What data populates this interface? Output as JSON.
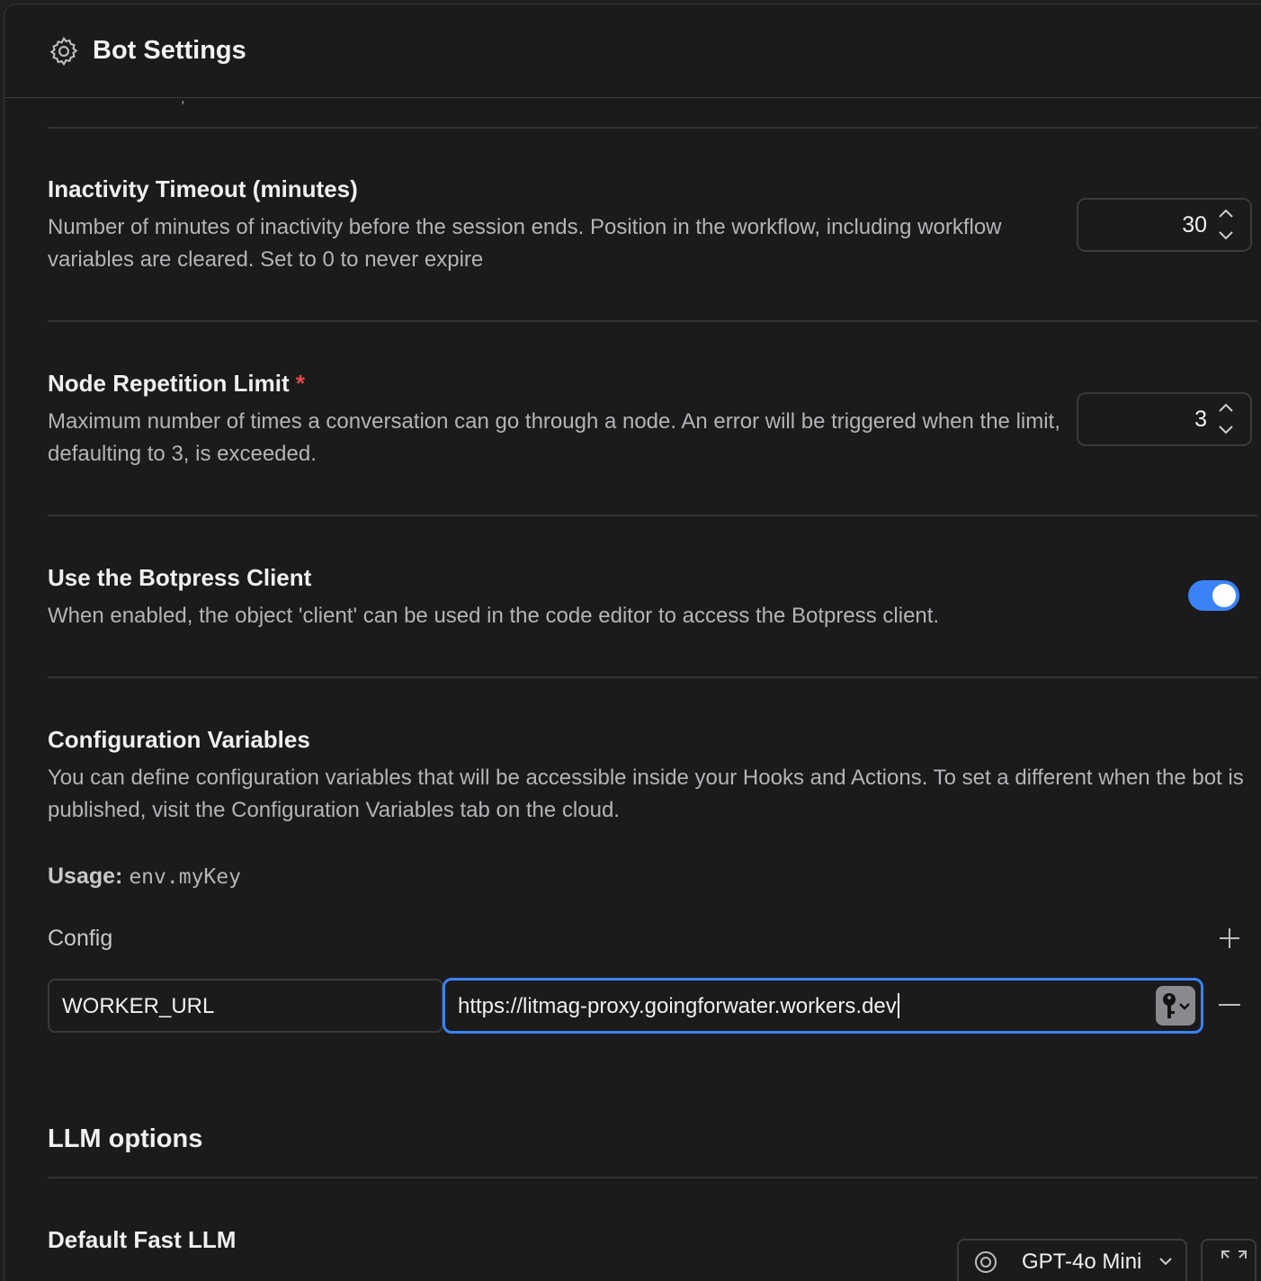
{
  "header": {
    "title": "Bot Settings",
    "icon": "gear-icon"
  },
  "inactivity": {
    "title": "Inactivity Timeout (minutes)",
    "description": "Number of minutes of inactivity before the session ends. Position in the workflow, including workflow variables are cleared. Set to 0 to never expire",
    "value": "30"
  },
  "node_repetition": {
    "title": "Node Repetition Limit",
    "required_marker": "*",
    "description": "Maximum number of times a conversation can go through a node. An error will be triggered when the limit, defaulting to 3, is exceeded.",
    "value": "3"
  },
  "botpress_client": {
    "title": "Use the Botpress Client",
    "description": "When enabled, the object 'client' can be used in the code editor to access the Botpress client.",
    "enabled": true
  },
  "config_vars": {
    "title": "Configuration Variables",
    "description": "You can define configuration variables that will be accessible inside your Hooks and Actions. To set a different when the bot is published, visit the Configuration Variables tab on the cloud.",
    "usage_label": "Usage:",
    "usage_code": "env.myKey",
    "config_label": "Config",
    "rows": [
      {
        "key": "WORKER_URL",
        "value": "https://litmag-proxy.goingforwater.workers.dev"
      }
    ]
  },
  "llm": {
    "title": "LLM options",
    "default_fast_title": "Default Fast LLM",
    "default_fast_model": "GPT-4o Mini"
  },
  "colors": {
    "accent": "#3b82f6",
    "required": "#e5484d"
  }
}
